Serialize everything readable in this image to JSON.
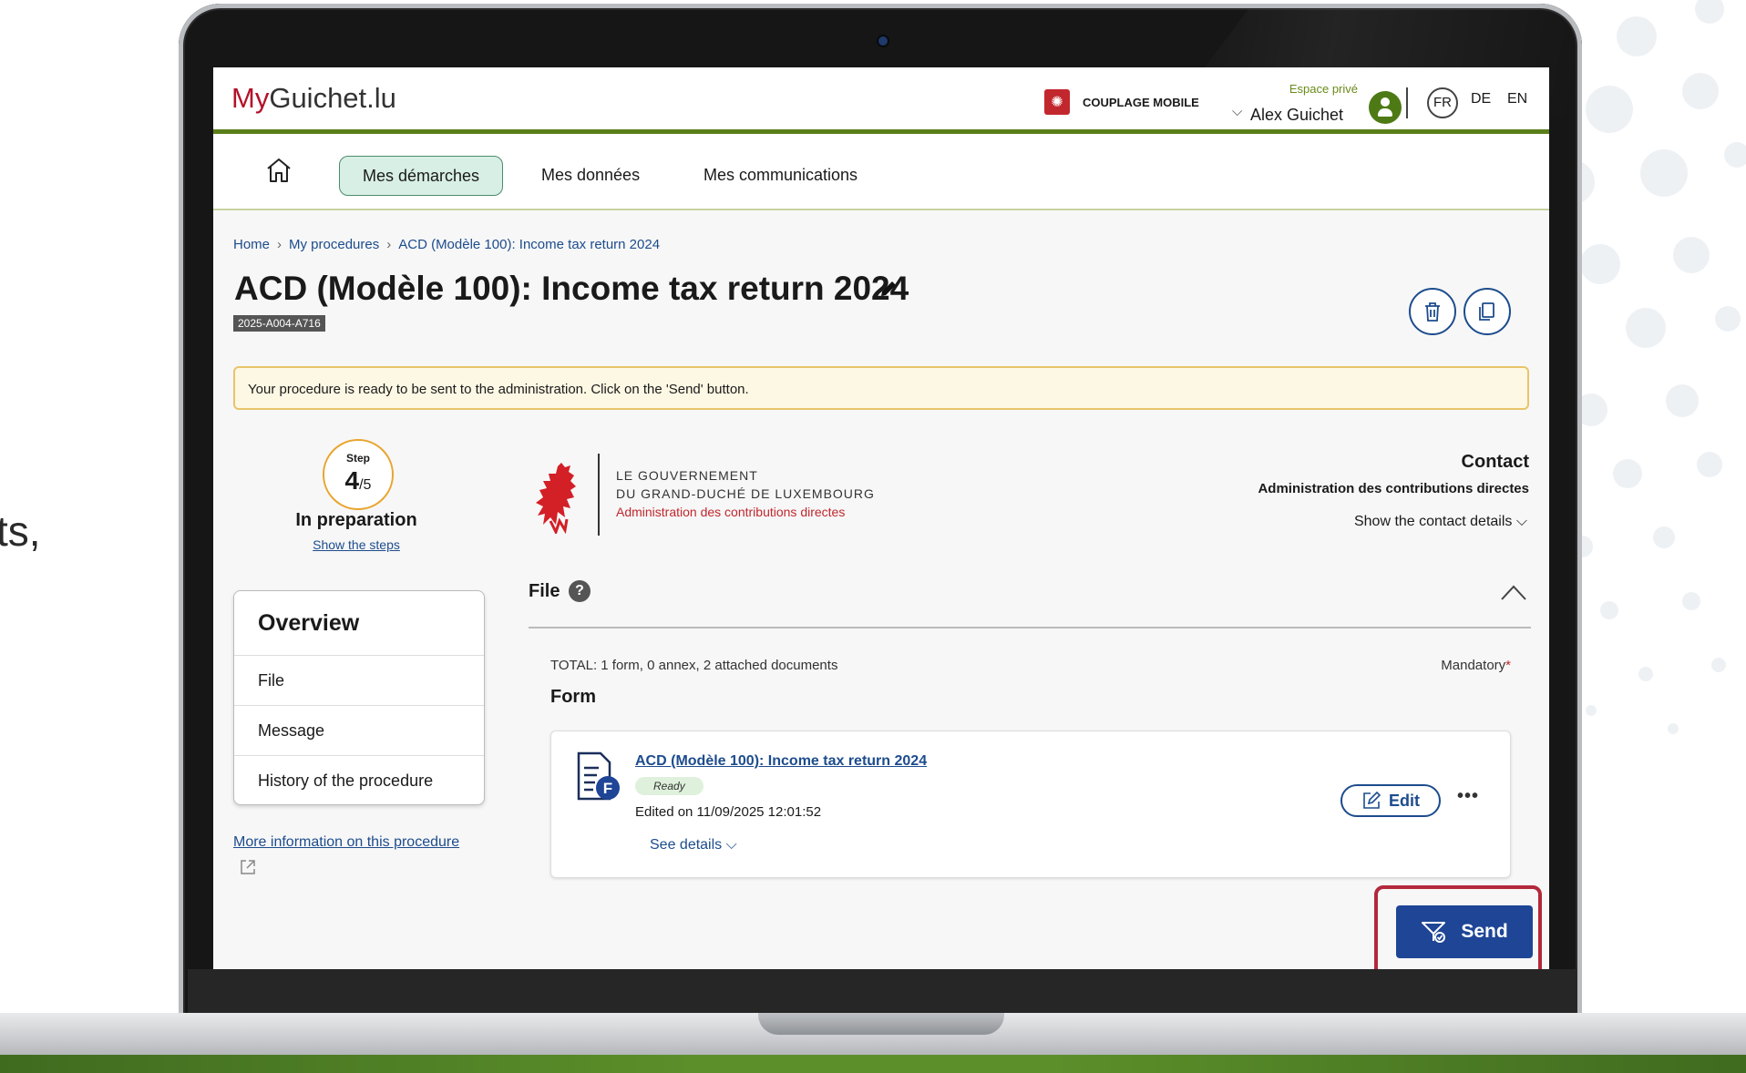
{
  "background": {
    "partial_text": "ts,"
  },
  "header": {
    "logo_prefix": "My",
    "logo_rest": "Guichet.lu",
    "coupling_label": "COUPLAGE MOBILE",
    "space_label": "Espace privé",
    "user_name": "Alex Guichet",
    "languages": [
      "FR",
      "DE",
      "EN"
    ],
    "active_language": "FR"
  },
  "nav": {
    "items": [
      "Mes démarches",
      "Mes données",
      "Mes communications"
    ],
    "active": "Mes démarches"
  },
  "breadcrumb": [
    "Home",
    "My procedures",
    "ACD (Modèle 100): Income tax return 2024"
  ],
  "procedure": {
    "title": "ACD (Modèle 100): Income tax return 2024",
    "reference": "2025-A004-A716"
  },
  "alert": {
    "message": "Your procedure is ready to be sent to the administration. Click on the 'Send' button."
  },
  "step": {
    "label": "Step",
    "current": "4",
    "total": "/5",
    "status": "In preparation",
    "link": "Show the steps"
  },
  "government": {
    "line1": "LE GOUVERNEMENT",
    "line2": "DU GRAND-DUCHÉ DE LUXEMBOURG",
    "line3": "Administration des contributions directes"
  },
  "contact": {
    "title": "Contact",
    "organisation": "Administration des contributions directes",
    "details_link": "Show the contact details"
  },
  "overview": {
    "title": "Overview",
    "items": [
      "File",
      "Message",
      "History of the procedure"
    ],
    "more_info": "More information on this procedure"
  },
  "file": {
    "title": "File",
    "help": "?",
    "total": "TOTAL: 1 form, 0 annex, 2 attached documents",
    "mandatory": "Mandatory",
    "required_mark": "*",
    "form_heading": "Form",
    "form": {
      "name": "ACD (Modèle 100): Income tax return 2024",
      "status": "Ready",
      "edited": "Edited on 11/09/2025 12:01:52",
      "see_details": "See details",
      "edit_label": "Edit",
      "more_label": "•••"
    }
  },
  "actions": {
    "send_label": "Send"
  },
  "colors": {
    "brand_red": "#b3122a",
    "brand_green": "#5a7f1a",
    "primary_blue": "#1e4596",
    "highlight": "#b3283b"
  }
}
